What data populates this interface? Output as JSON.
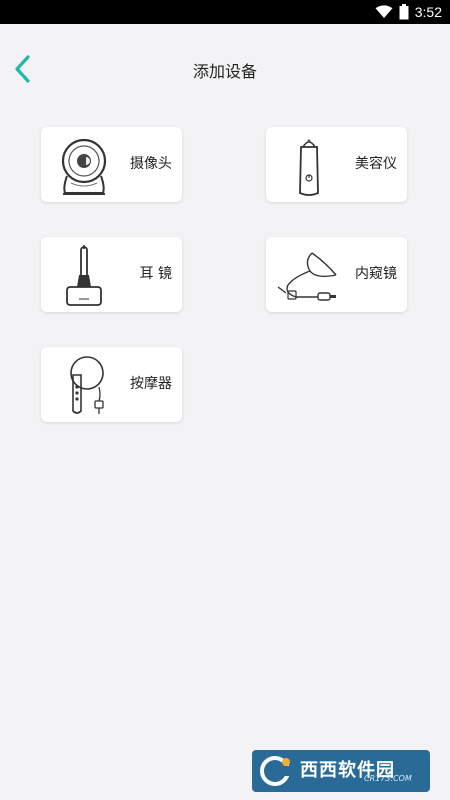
{
  "status_bar": {
    "time": "3:52",
    "icons": [
      "wifi-icon",
      "battery-icon"
    ]
  },
  "header": {
    "title": "添加设备",
    "back_icon": "chevron-left-icon"
  },
  "colors": {
    "accent": "#1fb8a7",
    "background": "#f3f3f5",
    "card": "#ffffff"
  },
  "devices": [
    {
      "label": "摄像头",
      "icon": "camera-icon"
    },
    {
      "label": "美容仪",
      "icon": "beauty-device-icon"
    },
    {
      "label": "耳 镜",
      "icon": "otoscope-icon"
    },
    {
      "label": "内窥镜",
      "icon": "endoscope-icon"
    },
    {
      "label": "按摩器",
      "icon": "massager-icon"
    }
  ],
  "watermark": {
    "text": "西西软件园",
    "url": "CR173.COM"
  }
}
